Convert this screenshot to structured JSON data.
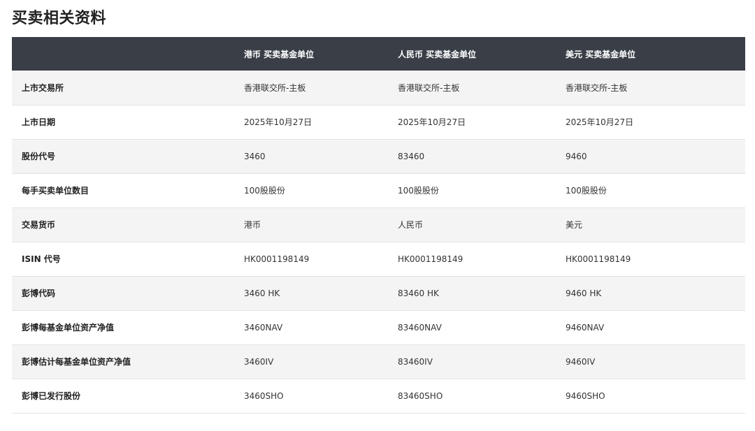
{
  "page": {
    "title": "买卖相关资料"
  },
  "table": {
    "headers": [
      "",
      "港币 买卖基金单位",
      "人民币 买卖基金单位",
      "美元 买卖基金单位"
    ],
    "rows": [
      {
        "label": "上市交易所",
        "values": [
          "香港联交所-主板",
          "香港联交所-主板",
          "香港联交所-主板"
        ]
      },
      {
        "label": "上市日期",
        "values": [
          "2025年10月27日",
          "2025年10月27日",
          "2025年10月27日"
        ]
      },
      {
        "label": "股份代号",
        "values": [
          "3460",
          "83460",
          "9460"
        ]
      },
      {
        "label": "每手买卖单位数目",
        "values": [
          "100股股份",
          "100股股份",
          "100股股份"
        ]
      },
      {
        "label": "交易货币",
        "values": [
          "港币",
          "人民币",
          "美元"
        ]
      },
      {
        "label": "ISIN 代号",
        "values": [
          "HK0001198149",
          "HK0001198149",
          "HK0001198149"
        ]
      },
      {
        "label": "彭博代码",
        "values": [
          "3460 HK",
          "83460 HK",
          "9460 HK"
        ]
      },
      {
        "label": "彭博每基金单位资产净值",
        "values": [
          "3460NAV",
          "83460NAV",
          "9460NAV"
        ]
      },
      {
        "label": "彭博估计每基金单位资产净值",
        "values": [
          "3460IV",
          "83460IV",
          "9460IV"
        ]
      },
      {
        "label": "彭博已发行股份",
        "values": [
          "3460SHO",
          "83460SHO",
          "9460SHO"
        ]
      }
    ]
  },
  "colors": {
    "header_bg": "#3a3f47",
    "stripe_bg": "#f4f4f4",
    "row_border": "#e3e3e3"
  }
}
